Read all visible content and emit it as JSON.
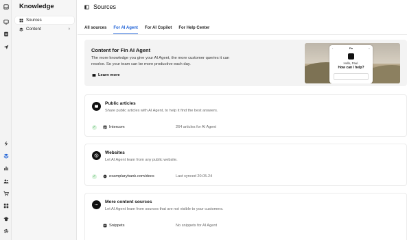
{
  "sidebar": {
    "title": "Knowledge",
    "items": [
      {
        "label": "Sources",
        "icon": "grid-icon",
        "active": true
      },
      {
        "label": "Content",
        "icon": "layers-icon",
        "active": false
      }
    ]
  },
  "header": {
    "title": "Sources"
  },
  "tabs": [
    {
      "label": "All sources",
      "active": false
    },
    {
      "label": "For AI Agent",
      "active": true
    },
    {
      "label": "For AI Copilot",
      "active": false
    },
    {
      "label": "For Help Center",
      "active": false
    }
  ],
  "hero": {
    "title": "Content for Fin AI Agent",
    "description": "The more knowledge you give your AI Agent, the more customer queries it can resolve. So your team can be more productive each day.",
    "learn_more": "Learn more",
    "preview": {
      "top": "Fin",
      "greeting": "Hello, Paul.",
      "help": "How can I help?"
    }
  },
  "cards": [
    {
      "title": "Public articles",
      "subtitle": "Share public articles with AI Agent, to help it find the best answers.",
      "row": {
        "name": "Intercom",
        "meta": "264 articles for AI Agent",
        "synced": true
      }
    },
    {
      "title": "Websites",
      "subtitle": "Let AI Agent learn from any public website.",
      "row": {
        "name": "examplarybank.com/docs",
        "meta": "Last synced 20.05.24",
        "synced": true
      }
    },
    {
      "title": "More content sources",
      "subtitle": "Let AI Agent learn from sources that are not visible to your customers.",
      "row": {
        "name": "Snippets",
        "meta": "No snippets for AI Agent",
        "synced": false
      }
    }
  ],
  "colors": {
    "accent": "#1b5fd6",
    "success": "#2f9e44"
  }
}
